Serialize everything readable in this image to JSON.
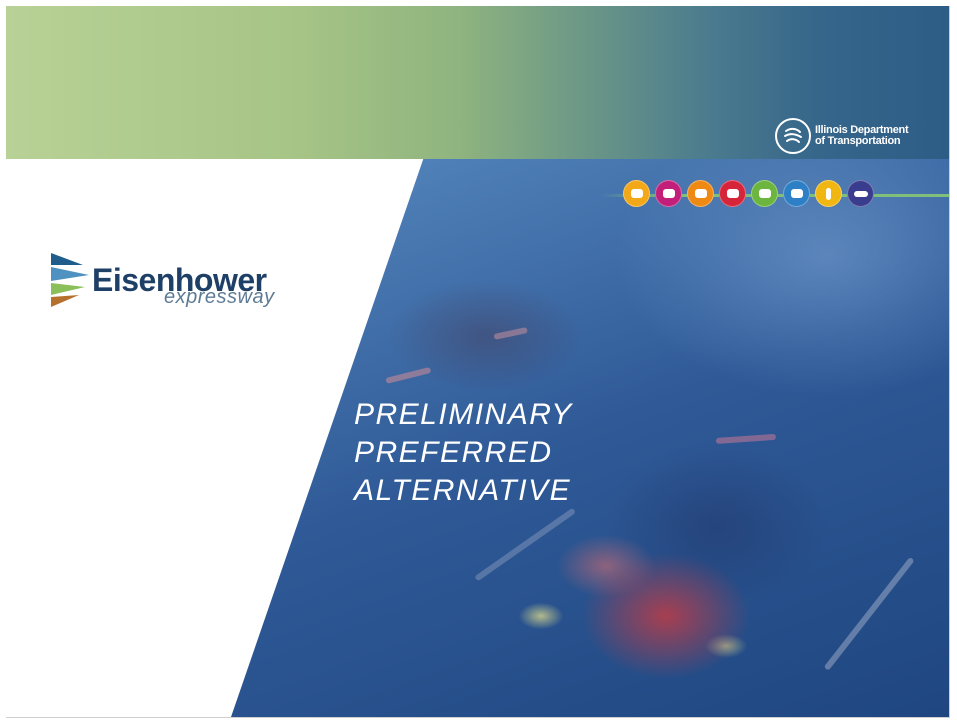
{
  "agency": {
    "line1": "Illinois Department",
    "line2": "of Transportation",
    "seal_icon": "idot-seal-icon"
  },
  "project_logo": {
    "name": "Eisenhower",
    "subtitle": "expressway",
    "colors": {
      "name": "#1e3f66",
      "subtitle": "#5d7b95"
    }
  },
  "mode_icons": [
    {
      "icon": "car-icon",
      "color": "#f2a818"
    },
    {
      "icon": "carpool-icon",
      "color": "#c21f7a"
    },
    {
      "icon": "taxi-icon",
      "color": "#ee8a14"
    },
    {
      "icon": "vanpool-icon",
      "color": "#d6243a"
    },
    {
      "icon": "bus-icon",
      "color": "#6cb53f"
    },
    {
      "icon": "rail-icon",
      "color": "#2d7fc6"
    },
    {
      "icon": "pedestrian-icon",
      "color": "#f0b712"
    },
    {
      "icon": "bicycle-icon",
      "color": "#3a3c8e"
    }
  ],
  "title": {
    "line1": "PRELIMINARY",
    "line2": "PREFERRED",
    "line3": "ALTERNATIVE"
  },
  "colors": {
    "band_start": "#b8d196",
    "band_end": "#2d5c86",
    "photo_blue": "#2f5a97"
  }
}
